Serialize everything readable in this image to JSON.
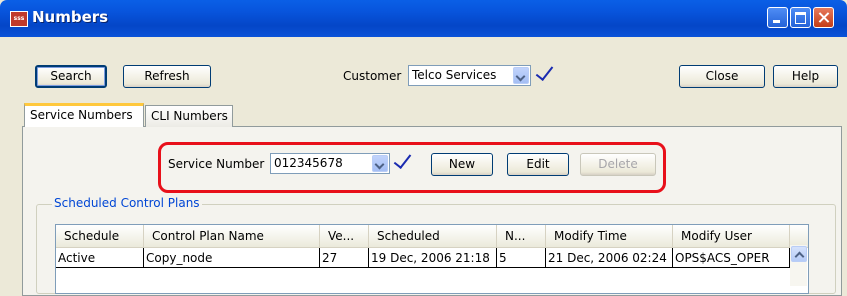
{
  "window": {
    "title": "Numbers",
    "icon": "app-icon"
  },
  "toolbar": {
    "search_label": "Search",
    "refresh_label": "Refresh",
    "customer_label": "Customer",
    "customer_value": "Telco Services",
    "close_label": "Close",
    "help_label": "Help"
  },
  "tabs": [
    {
      "label": "Service Numbers",
      "active": true
    },
    {
      "label": "CLI Numbers",
      "active": false
    }
  ],
  "service_number": {
    "label": "Service Number",
    "value": "012345678",
    "new_label": "New",
    "edit_label": "Edit",
    "delete_label": "Delete"
  },
  "plans": {
    "title": "Scheduled Control Plans",
    "columns": [
      "Schedule",
      "Control Plan Name",
      "Ve...",
      "Scheduled",
      "N...",
      "Modify Time",
      "Modify User"
    ],
    "rows": [
      [
        "Active",
        "Copy_node",
        "27",
        "19 Dec, 2006 21:18",
        "5",
        "21 Dec, 2006 02:24",
        "OPS$ACS_OPER"
      ]
    ]
  },
  "colors": {
    "titlebar": "#0855dd",
    "highlight": "#e8101a",
    "group_title": "#0046d5"
  }
}
